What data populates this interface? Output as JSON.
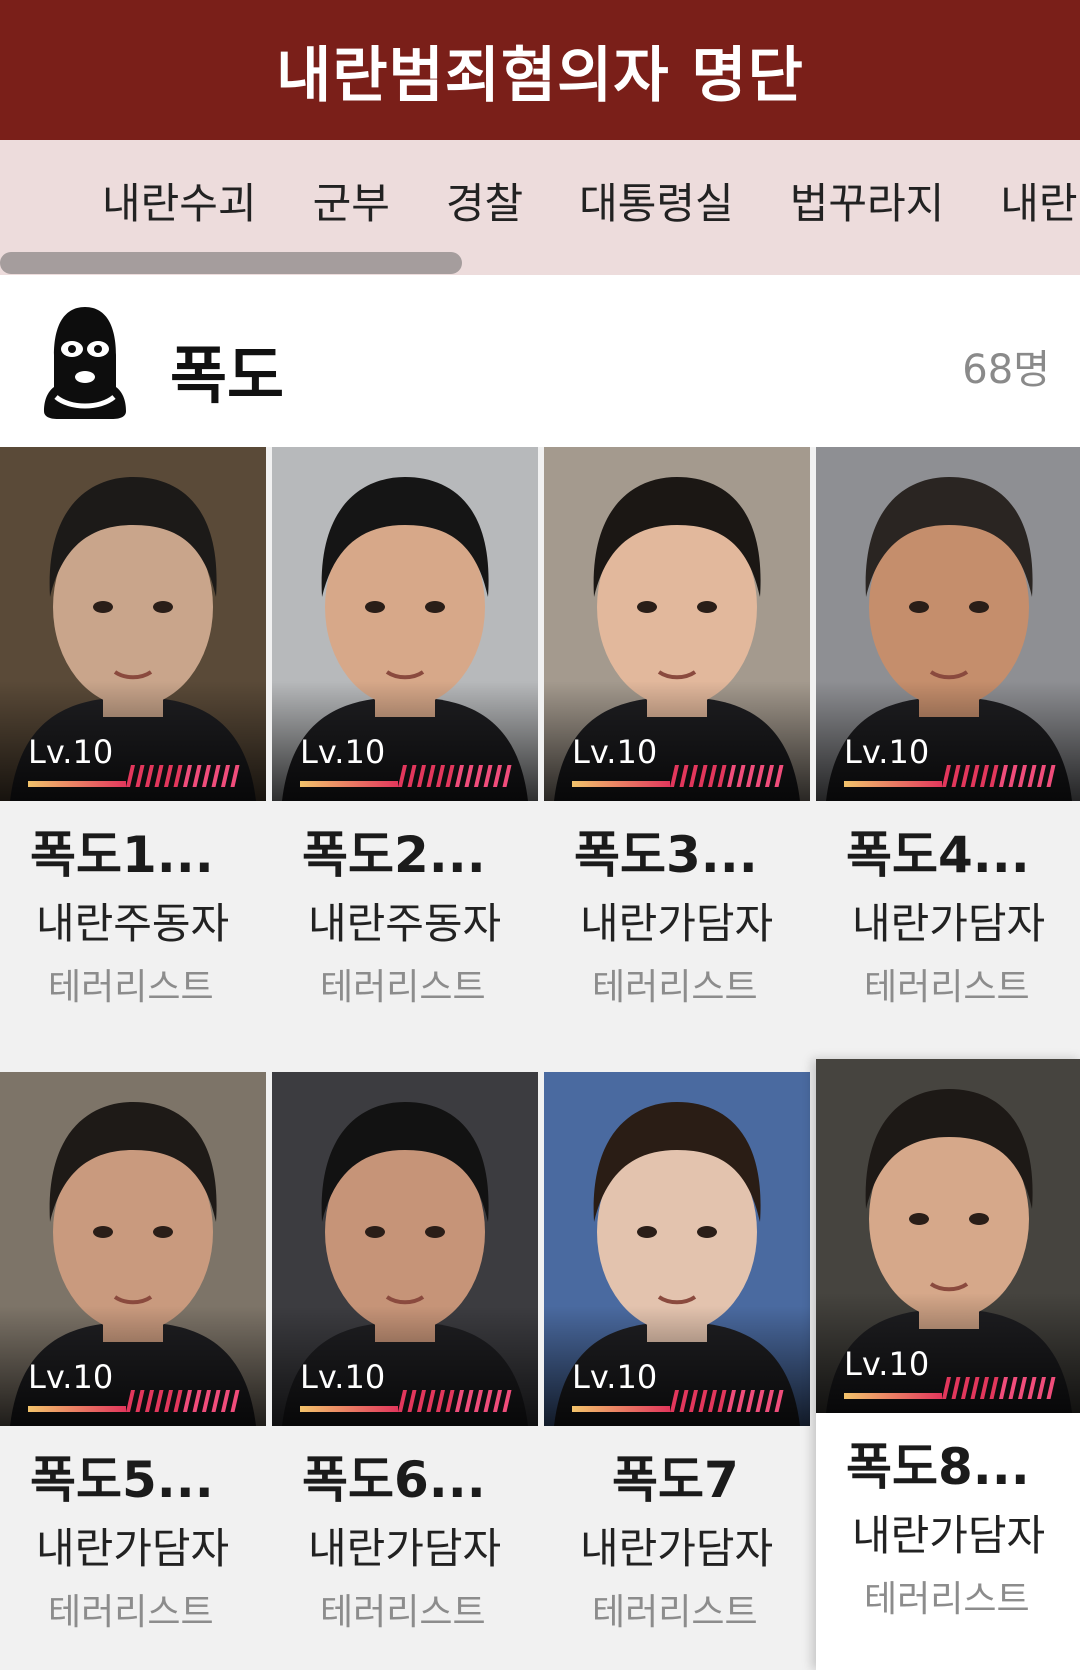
{
  "header": {
    "title": "내란범죄혐의자 명단"
  },
  "tabs": [
    "내란수괴",
    "군부",
    "경찰",
    "대통령실",
    "법꾸라지",
    "내란"
  ],
  "section": {
    "title": "폭도",
    "count": "68명",
    "icon": "balaclava-mask-icon"
  },
  "cards": [
    {
      "level": "Lv.10",
      "name": "폭도1...",
      "role": "내란주동자",
      "tag": "테러리스트",
      "bg": "#5a4a38",
      "skin": "#c9a58b",
      "hair": "#1c1a18"
    },
    {
      "level": "Lv.10",
      "name": "폭도2...",
      "role": "내란주동자",
      "tag": "테러리스트",
      "bg": "#b7b9bb",
      "skin": "#d7a889",
      "hair": "#151515"
    },
    {
      "level": "Lv.10",
      "name": "폭도3...",
      "role": "내란가담자",
      "tag": "테러리스트",
      "bg": "#a49a8e",
      "skin": "#e2b89c",
      "hair": "#1b1714"
    },
    {
      "level": "Lv.10",
      "name": "폭도4...",
      "role": "내란가담자",
      "tag": "테러리스트",
      "bg": "#8e8f93",
      "skin": "#c58e6c",
      "hair": "#2a2522"
    },
    {
      "level": "Lv.10",
      "name": "폭도5...",
      "role": "내란가담자",
      "tag": "테러리스트",
      "bg": "#7d7468",
      "skin": "#c99a7e",
      "hair": "#1e1a17"
    },
    {
      "level": "Lv.10",
      "name": "폭도6...",
      "role": "내란가담자",
      "tag": "테러리스트",
      "bg": "#3c3c40",
      "skin": "#c69478",
      "hair": "#121212"
    },
    {
      "level": "Lv.10",
      "name": "폭도7",
      "role": "내란가담자",
      "tag": "테러리스트",
      "bg": "#4a6aa0",
      "skin": "#e3c3ae",
      "hair": "#2a1d15"
    },
    {
      "level": "Lv.10",
      "name": "폭도8...",
      "role": "내란가담자",
      "tag": "테러리스트",
      "bg": "#46443f",
      "skin": "#d6a88a",
      "hair": "#1d1916"
    }
  ]
}
